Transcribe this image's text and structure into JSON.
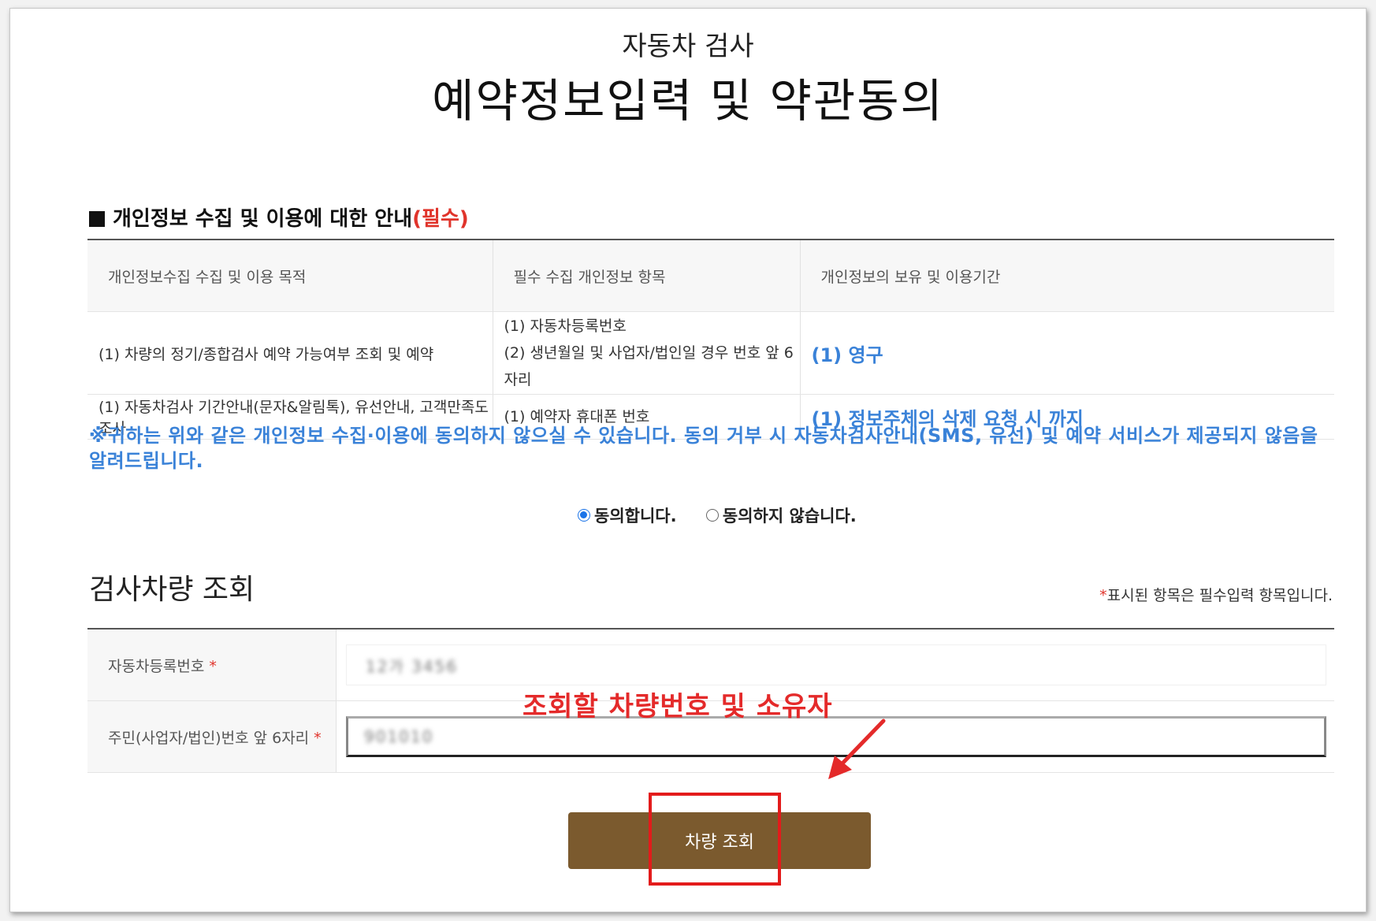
{
  "header": {
    "sub_title": "자동차 검사",
    "main_title": "예약정보입력 및 약관동의"
  },
  "privacy": {
    "heading": "개인정보 수집 및 이용에 대한 안내",
    "heading_required": "(필수)",
    "columns": [
      "개인정보수집 수집 및 이용 목적",
      "필수 수집 개인정보 항목",
      "개인정보의 보유 및 이용기간"
    ],
    "rows": [
      {
        "purpose": "(1) 차량의 정기/종합검사 예약 가능여부 조회 및 예약",
        "items": [
          "(1) 자동차등록번호",
          "(2) 생년월일 및 사업자/법인일 경우 번호 앞 6자리"
        ],
        "period": "(1) 영구"
      },
      {
        "purpose": "(1) 자동차검사 기간안내(문자&알림톡), 유선안내, 고객만족도 조사",
        "items": [
          "(1) 예약자 휴대폰 번호"
        ],
        "period": "(1) 정보주체의 삭제 요청 시 까지"
      }
    ],
    "notice": "※귀하는 위와 같은 개인정보 수집·이용에 동의하지 않으실 수 있습니다. 동의 거부 시 자동차검사안내(SMS, 유선) 및 예약 서비스가 제공되지 않음을 알려드립니다.",
    "agree_label": "동의합니다.",
    "disagree_label": "동의하지 않습니다."
  },
  "lookup": {
    "title": "검사차량 조회",
    "required_star": "*",
    "required_note": "표시된 항목은 필수입력 항목입니다.",
    "fields": [
      {
        "label": "자동차등록번호",
        "value": "12가 3456"
      },
      {
        "label": "주민(사업자/법인)번호 앞 6자리",
        "value": "901010"
      }
    ],
    "button_label": "차량 조회"
  },
  "annotation": {
    "text": "조회할 차량번호 및 소유자",
    "color": "#e42a2a"
  },
  "colors": {
    "accent_blue": "#3a82d8",
    "required_red": "#e0342b",
    "button_brown": "#7b5a2e"
  }
}
